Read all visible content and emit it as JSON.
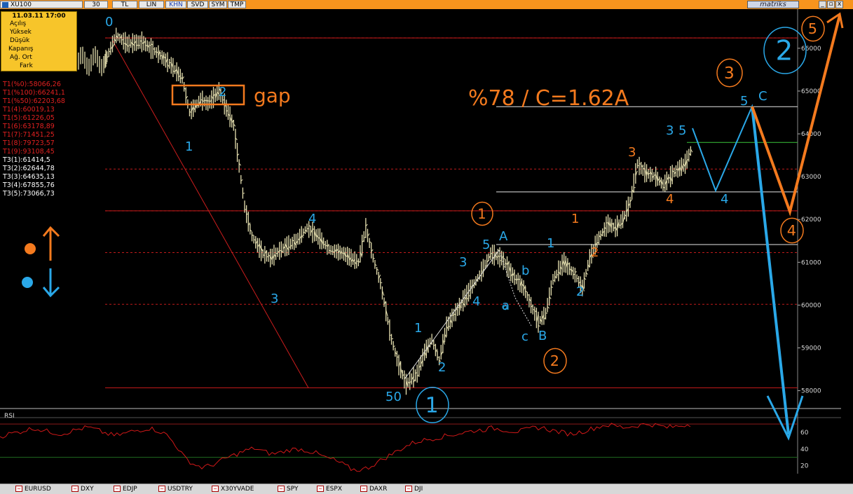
{
  "toolbar": {
    "symbol": "XU100",
    "period": "30",
    "buttons": [
      "TL",
      "LIN",
      "KHN",
      "SVD",
      "SYM",
      "TMP"
    ],
    "brand": "matriks",
    "window_buttons": [
      "_",
      "▫",
      "x"
    ]
  },
  "info_box": {
    "datetime": "11.03.11 17:00",
    "fields": [
      "Açılış",
      "Yüksek",
      "Düşük",
      "Kapanış",
      "Ağ. Ort",
      "Fark"
    ]
  },
  "levels_t1": [
    "T1(%0):58066,26",
    "T1(%100):66241,1",
    "T1(%50):62203,68",
    "T1(4):60019,13",
    "T1(5):61226,05",
    "T1(6):63178,89",
    "T1(7):71451,25",
    "T1(8):79723,57",
    "T1(9):93108,45"
  ],
  "levels_t3": [
    "T3(1):61414,5",
    "T3(2):62644,78",
    "T3(3):64635,13",
    "T3(4):67855,76",
    "T3(5):73066,73"
  ],
  "colors": {
    "price_bars": "#e6e0b0",
    "level_red": "#c21a1a",
    "annot_orange": "#f47a1e",
    "annot_blue": "#2aa8e8",
    "rsi_line": "#d01818",
    "titlebar": "#f7941d"
  },
  "chart_data": {
    "type": "bar",
    "title": "XU100",
    "y_ticks": [
      58000,
      59000,
      60000,
      61000,
      62000,
      63000,
      64000,
      65000,
      66000
    ],
    "ylim": [
      57600,
      66800
    ],
    "levels_dashed": [
      58066,
      60019,
      61226,
      62203,
      63178,
      66241
    ],
    "levels_solid_white": [
      61414,
      62644,
      64635
    ],
    "price_path": [
      [
        0,
        65700
      ],
      [
        3,
        66300
      ],
      [
        6,
        66100
      ],
      [
        10,
        66150
      ],
      [
        14,
        65900
      ],
      [
        18,
        65600
      ],
      [
        21,
        65300
      ],
      [
        23,
        64500
      ],
      [
        26,
        64800
      ],
      [
        28,
        64700
      ],
      [
        31,
        65000
      ],
      [
        33,
        64600
      ],
      [
        35,
        64200
      ],
      [
        38,
        62300
      ],
      [
        40,
        61600
      ],
      [
        43,
        61200
      ],
      [
        45,
        61100
      ],
      [
        48,
        61300
      ],
      [
        52,
        61500
      ],
      [
        55,
        61800
      ],
      [
        58,
        61600
      ],
      [
        61,
        61300
      ],
      [
        65,
        61200
      ],
      [
        69,
        61000
      ],
      [
        71,
        61800
      ],
      [
        73,
        61100
      ],
      [
        75,
        60500
      ],
      [
        78,
        59200
      ],
      [
        80,
        58600
      ],
      [
        82,
        58150
      ],
      [
        85,
        58400
      ],
      [
        87,
        58900
      ],
      [
        89,
        59200
      ],
      [
        91,
        58700
      ],
      [
        93,
        59500
      ],
      [
        96,
        59900
      ],
      [
        99,
        60300
      ],
      [
        102,
        60700
      ],
      [
        105,
        61200
      ],
      [
        108,
        61100
      ],
      [
        111,
        60700
      ],
      [
        114,
        60400
      ],
      [
        116,
        60000
      ],
      [
        118,
        59600
      ],
      [
        120,
        59800
      ],
      [
        122,
        60600
      ],
      [
        125,
        61000
      ],
      [
        128,
        60700
      ],
      [
        130,
        60400
      ],
      [
        132,
        61100
      ],
      [
        134,
        61500
      ],
      [
        137,
        61900
      ],
      [
        139,
        61800
      ],
      [
        141,
        62000
      ],
      [
        143,
        62400
      ],
      [
        145,
        63300
      ],
      [
        147,
        63100
      ],
      [
        150,
        63000
      ],
      [
        152,
        62800
      ],
      [
        155,
        63100
      ],
      [
        158,
        63300
      ],
      [
        160,
        63700
      ]
    ],
    "rsi": {
      "label": "RSI",
      "y_ticks": [
        20,
        40,
        60
      ],
      "ylim": [
        12,
        76
      ],
      "values": [
        55,
        58,
        60,
        63,
        65,
        62,
        60,
        58,
        61,
        64,
        66,
        63,
        59,
        56,
        58,
        61,
        63,
        65,
        62,
        57,
        45,
        30,
        22,
        18,
        20,
        25,
        30,
        34,
        38,
        41,
        37,
        34,
        36,
        39,
        40,
        38,
        35,
        30,
        27,
        22,
        16,
        14,
        18,
        24,
        30,
        36,
        42,
        47,
        50,
        52,
        54,
        56,
        58,
        60,
        62,
        63,
        65,
        64,
        62,
        61,
        63,
        66,
        65,
        62,
        60,
        58,
        60,
        63,
        66,
        69,
        68,
        66,
        67,
        69,
        70,
        68,
        66,
        67,
        69,
        70
      ]
    }
  },
  "annotations": {
    "wave_labels": [
      "0",
      "1",
      "2",
      "3",
      "4",
      "5",
      "1",
      "2",
      "3",
      "4",
      "5",
      "A",
      "a",
      "b",
      "c",
      "B",
      "1",
      "2",
      "1",
      "2",
      "3",
      "4",
      "3",
      "5",
      "4",
      "5",
      "C"
    ],
    "circled": [
      "1",
      "2",
      "3",
      "4",
      "5",
      "2"
    ],
    "text_gap": "gap",
    "text_target": "%78 / C=1.62A",
    "text_50": "50"
  },
  "bottom_symbols": [
    "EURUSD",
    "DXY",
    "EDJP",
    "USDTRY",
    "X30YVADE",
    "SPY",
    "ESPX",
    "DAXR",
    "DJI"
  ]
}
